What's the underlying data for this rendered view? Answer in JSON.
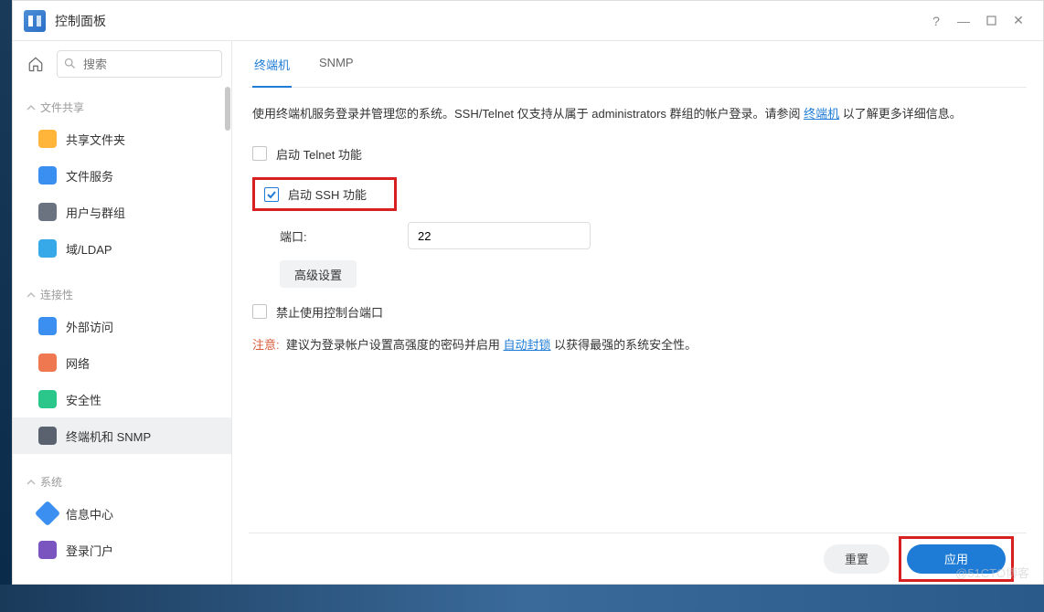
{
  "window": {
    "title": "控制面板"
  },
  "search": {
    "placeholder": "搜索"
  },
  "sidebar": {
    "sections": [
      {
        "label": "文件共享",
        "items": [
          {
            "label": "共享文件夹"
          },
          {
            "label": "文件服务"
          },
          {
            "label": "用户与群组"
          },
          {
            "label": "域/LDAP"
          }
        ]
      },
      {
        "label": "连接性",
        "items": [
          {
            "label": "外部访问"
          },
          {
            "label": "网络"
          },
          {
            "label": "安全性"
          },
          {
            "label": "终端机和 SNMP",
            "active": true
          }
        ]
      },
      {
        "label": "系统",
        "items": [
          {
            "label": "信息中心"
          },
          {
            "label": "登录门户"
          }
        ]
      }
    ]
  },
  "tabs": [
    {
      "label": "终端机",
      "active": true
    },
    {
      "label": "SNMP"
    }
  ],
  "content": {
    "desc_part1": "使用终端机服务登录并管理您的系统。SSH/Telnet 仅支持从属于 administrators 群组的帐户登录。请参阅 ",
    "desc_link": "终端机",
    "desc_part2": " 以了解更多详细信息。",
    "telnet_label": "启动 Telnet 功能",
    "ssh_label": "启动 SSH 功能",
    "port_label": "端口:",
    "port_value": "22",
    "advanced_label": "高级设置",
    "console_label": "禁止使用控制台端口",
    "note_label": "注意:",
    "note_text1": "建议为登录帐户设置高强度的密码并启用 ",
    "note_link": "自动封锁",
    "note_text2": " 以获得最强的系统安全性。"
  },
  "footer": {
    "reset": "重置",
    "apply": "应用"
  },
  "watermark": "@51CTO博客"
}
